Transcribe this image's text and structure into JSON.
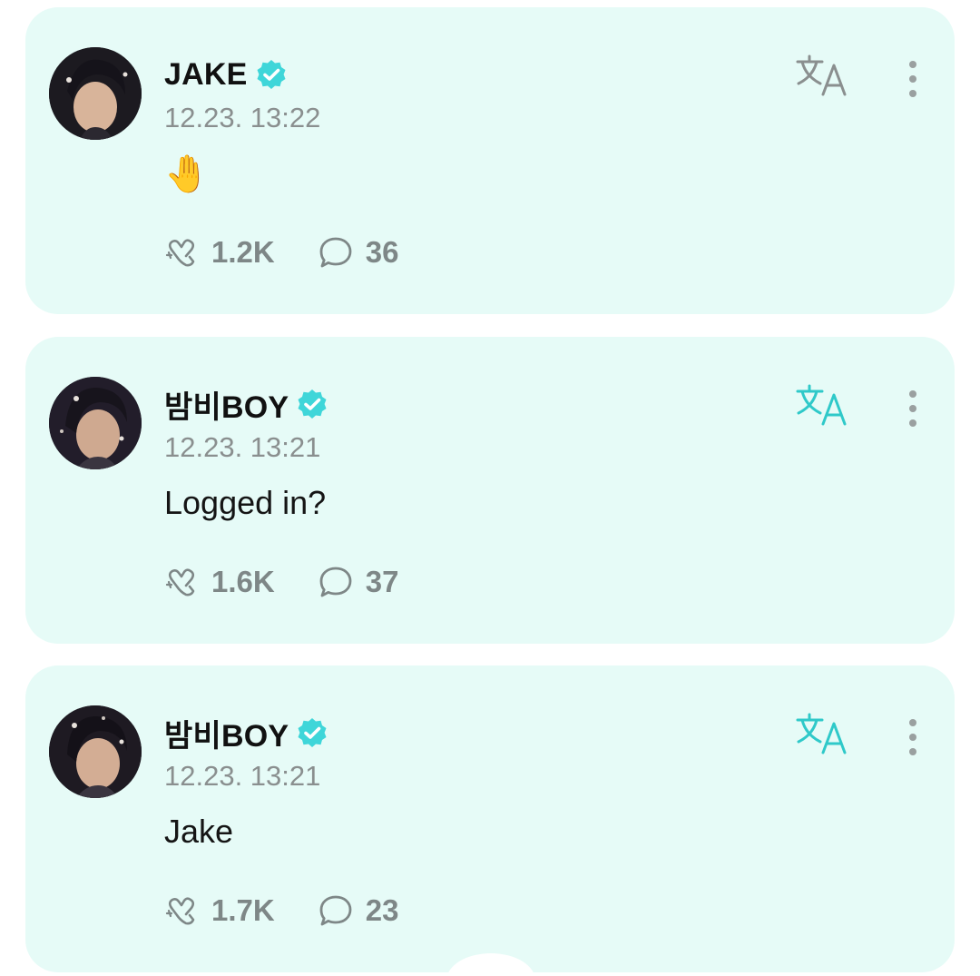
{
  "colors": {
    "card_bg": "#e6fbf7",
    "accent": "#3fd6d9",
    "translate_active": "#2fc9c9",
    "translate_inactive": "#8a8f8f",
    "meta_gray": "#8a8f8f"
  },
  "posts": [
    {
      "author": "JAKE",
      "verified": true,
      "timestamp": "12.23. 13:22",
      "message": "🤚",
      "reactions": "1.2K",
      "comments": "36",
      "translate_active": false
    },
    {
      "author": "밤비BOY",
      "verified": true,
      "timestamp": "12.23. 13:21",
      "message": "Logged in?",
      "reactions": "1.6K",
      "comments": "37",
      "translate_active": true
    },
    {
      "author": "밤비BOY",
      "verified": true,
      "timestamp": "12.23. 13:21",
      "message": "Jake",
      "reactions": "1.7K",
      "comments": "23",
      "translate_active": true
    }
  ],
  "icons": {
    "verified": "verified-badge-icon",
    "reaction": "reaction-heart-icon",
    "comment": "comment-bubble-icon",
    "translate": "translate-icon",
    "more": "more-vertical-icon"
  }
}
